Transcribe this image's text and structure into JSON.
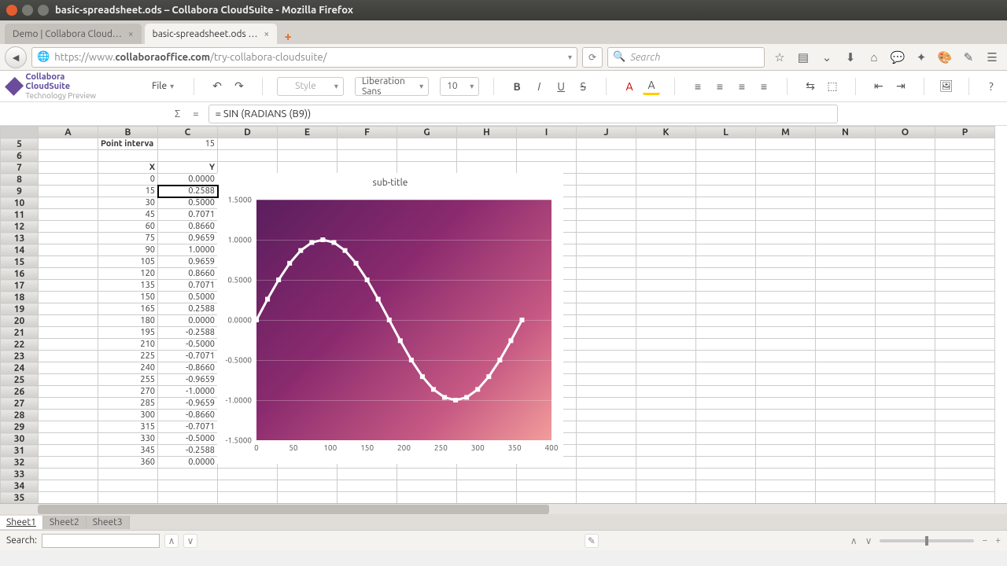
{
  "window": {
    "title": "basic-spreadsheet.ods – Collabora CloudSuite - Mozilla Firefox"
  },
  "browser": {
    "tabs": [
      {
        "label": "Demo | Collabora Cloud…",
        "active": false
      },
      {
        "label": "basic-spreadsheet.ods …",
        "active": true
      }
    ],
    "url_prefix": "https://www.",
    "url_host": "collaboraoffice.com",
    "url_path": "/try-collabora-cloudsuite/",
    "search_placeholder": "Search"
  },
  "app": {
    "logo_line1": "Collabora CloudSuite",
    "logo_line2": "Technology Preview",
    "file_menu": "File",
    "style_label": "Style",
    "font_name": "Liberation Sans",
    "font_size": "10"
  },
  "formula": "= SIN (RADIANS (B9))",
  "sheet": {
    "columns": [
      "A",
      "B",
      "C",
      "D",
      "E",
      "F",
      "G",
      "H",
      "I",
      "J",
      "K",
      "L",
      "M",
      "N",
      "O",
      "P"
    ],
    "first_row": 5,
    "last_row": 35,
    "point_interval_label": "Point interva",
    "point_interval_value": "15",
    "header_x": "X",
    "header_y": "Y",
    "selected_cell": "C9",
    "data_rows": [
      {
        "row": 8,
        "x": "0",
        "y": "0.0000"
      },
      {
        "row": 9,
        "x": "15",
        "y": "0.2588"
      },
      {
        "row": 10,
        "x": "30",
        "y": "0.5000"
      },
      {
        "row": 11,
        "x": "45",
        "y": "0.7071"
      },
      {
        "row": 12,
        "x": "60",
        "y": "0.8660"
      },
      {
        "row": 13,
        "x": "75",
        "y": "0.9659"
      },
      {
        "row": 14,
        "x": "90",
        "y": "1.0000"
      },
      {
        "row": 15,
        "x": "105",
        "y": "0.9659"
      },
      {
        "row": 16,
        "x": "120",
        "y": "0.8660"
      },
      {
        "row": 17,
        "x": "135",
        "y": "0.7071"
      },
      {
        "row": 18,
        "x": "150",
        "y": "0.5000"
      },
      {
        "row": 19,
        "x": "165",
        "y": "0.2588"
      },
      {
        "row": 20,
        "x": "180",
        "y": "0.0000"
      },
      {
        "row": 21,
        "x": "195",
        "y": "-0.2588"
      },
      {
        "row": 22,
        "x": "210",
        "y": "-0.5000"
      },
      {
        "row": 23,
        "x": "225",
        "y": "-0.7071"
      },
      {
        "row": 24,
        "x": "240",
        "y": "-0.8660"
      },
      {
        "row": 25,
        "x": "255",
        "y": "-0.9659"
      },
      {
        "row": 26,
        "x": "270",
        "y": "-1.0000"
      },
      {
        "row": 27,
        "x": "285",
        "y": "-0.9659"
      },
      {
        "row": 28,
        "x": "300",
        "y": "-0.8660"
      },
      {
        "row": 29,
        "x": "315",
        "y": "-0.7071"
      },
      {
        "row": 30,
        "x": "330",
        "y": "-0.5000"
      },
      {
        "row": 31,
        "x": "345",
        "y": "-0.2588"
      },
      {
        "row": 32,
        "x": "360",
        "y": "0.0000"
      }
    ]
  },
  "sheets_tabs": [
    "Sheet1",
    "Sheet2",
    "Sheet3"
  ],
  "sheets_tab_active": 0,
  "search_label": "Search:",
  "chart_data": {
    "type": "line",
    "subtitle": "sub-title",
    "x": [
      0,
      15,
      30,
      45,
      60,
      75,
      90,
      105,
      120,
      135,
      150,
      165,
      180,
      195,
      210,
      225,
      240,
      255,
      270,
      285,
      300,
      315,
      330,
      345,
      360
    ],
    "y": [
      0.0,
      0.2588,
      0.5,
      0.7071,
      0.866,
      0.9659,
      1.0,
      0.9659,
      0.866,
      0.7071,
      0.5,
      0.2588,
      0.0,
      -0.2588,
      -0.5,
      -0.7071,
      -0.866,
      -0.9659,
      -1.0,
      -0.9659,
      -0.866,
      -0.7071,
      -0.5,
      -0.2588,
      0.0
    ],
    "xlim": [
      0,
      400
    ],
    "ylim": [
      -1.5,
      1.5
    ],
    "xticks": [
      0,
      50,
      100,
      150,
      200,
      250,
      300,
      350,
      400
    ],
    "yticks": [
      -1.5,
      -1.0,
      -0.5,
      0.0,
      0.5,
      1.0,
      1.5
    ],
    "ytick_labels": [
      "-1.5000",
      "-1.0000",
      "-0.5000",
      "0.0000",
      "0.5000",
      "1.0000",
      "1.5000"
    ]
  }
}
